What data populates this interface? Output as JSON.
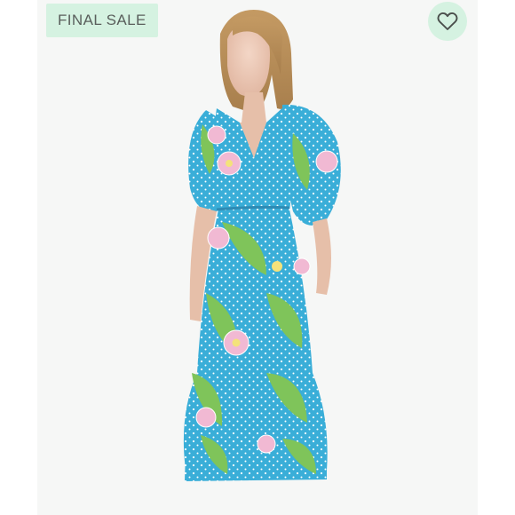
{
  "listing": {
    "badge_label": "FINAL SALE",
    "like_icon": "heart-outline-icon",
    "photo_subject": "model-wearing-floral-wrap-dress"
  },
  "colors": {
    "badge_bg": "#d5f2e1",
    "badge_text": "#5a5f5c",
    "dress_blue": "#3aaed8",
    "dress_green": "#7fc45a",
    "dress_pink": "#f1b9d3",
    "heart_stroke": "#4a4f4c"
  }
}
